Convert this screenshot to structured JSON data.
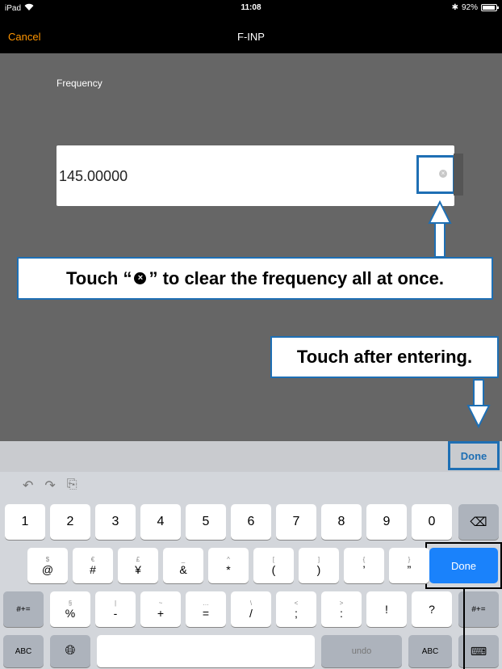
{
  "status": {
    "device": "iPad",
    "time": "11:08",
    "battery": "92%",
    "battery_level": 0.92
  },
  "nav": {
    "cancel": "Cancel",
    "title": "F-INP"
  },
  "form": {
    "label": "Frequency",
    "value": "145.00000"
  },
  "callouts": {
    "clear": {
      "pre": "Touch “",
      "post": "” to clear the frequency all at once."
    },
    "done": "Touch after entering."
  },
  "keyboard": {
    "toolbar_done": "Done",
    "row1": [
      "1",
      "2",
      "3",
      "4",
      "5",
      "6",
      "7",
      "8",
      "9",
      "0"
    ],
    "row2": [
      {
        "alt": "$",
        "main": "@"
      },
      {
        "alt": "€",
        "main": "#"
      },
      {
        "alt": "£",
        "main": "¥"
      },
      {
        "alt": "_",
        "main": "&"
      },
      {
        "alt": "^",
        "main": "*"
      },
      {
        "alt": "[",
        "main": "("
      },
      {
        "alt": "]",
        "main": ")"
      },
      {
        "alt": "{",
        "main": "’"
      },
      {
        "alt": "}",
        "main": "”"
      }
    ],
    "row2_done": "Done",
    "row3_left": "#+=",
    "row3": [
      {
        "alt": "§",
        "main": "%"
      },
      {
        "alt": "|",
        "main": "-"
      },
      {
        "alt": "~",
        "main": "+"
      },
      {
        "alt": "…",
        "main": "="
      },
      {
        "alt": "\\",
        "main": "/"
      },
      {
        "alt": "<",
        "main": ";"
      },
      {
        "alt": ">",
        "main": ":"
      },
      {
        "alt": "",
        "main": "!"
      },
      {
        "alt": "",
        "main": "?"
      }
    ],
    "row3_right": "#+=",
    "row4_abc": "ABC",
    "undo": "undo",
    "row4_abc_right": "ABC"
  }
}
